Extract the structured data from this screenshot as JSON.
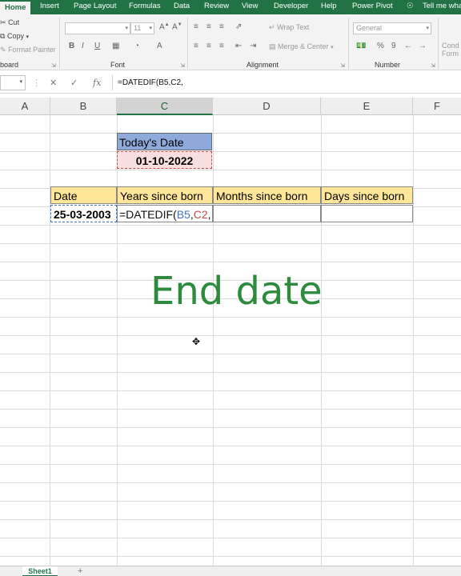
{
  "ribbon": {
    "tabs": [
      "Home",
      "Insert",
      "Page Layout",
      "Formulas",
      "Data",
      "Review",
      "View",
      "Developer",
      "Help",
      "Power Pivot",
      "Tell me wha"
    ],
    "clipboard": {
      "cut": "Cut",
      "copy": "Copy",
      "format_painter": "Format Painter",
      "label": "board"
    },
    "font": {
      "size": "11",
      "label": "Font",
      "bold": "B",
      "italic": "I",
      "underline": "U"
    },
    "alignment": {
      "wrap_text": "Wrap Text",
      "merge_center": "Merge & Center",
      "label": "Alignment"
    },
    "number": {
      "format": "General",
      "percent": "%",
      "comma": "9",
      "label": "Number"
    },
    "styles": {
      "conditional": "Cond",
      "conditional2": "Form"
    }
  },
  "formula_bar": {
    "name_box": "",
    "fx": "fx",
    "formula": "=DATEDIF(B5,C2,"
  },
  "columns": [
    "A",
    "B",
    "C",
    "D",
    "E",
    "F"
  ],
  "sheet": {
    "today_label": "Today's Date",
    "today_value": "01-10-2022",
    "headers": [
      "Date",
      "Years since born",
      "Months since born",
      "Days since born"
    ],
    "b5": "25-03-2003",
    "c5_prefix": "=DATEDIF(",
    "c5_ref1": "B5",
    "c5_comma1": ",",
    "c5_ref2": "C2",
    "c5_comma2": ","
  },
  "overlay": {
    "text": "End date"
  },
  "sheet_tabs": {
    "active": "Sheet1",
    "add": "+"
  },
  "colors": {
    "brand": "#217346",
    "today_fill": "#8ea9db",
    "header_fill": "#ffe699",
    "overlay_text": "#2e8b3e",
    "ref_blue": "#4472c4",
    "ref_red": "#c0504d"
  }
}
